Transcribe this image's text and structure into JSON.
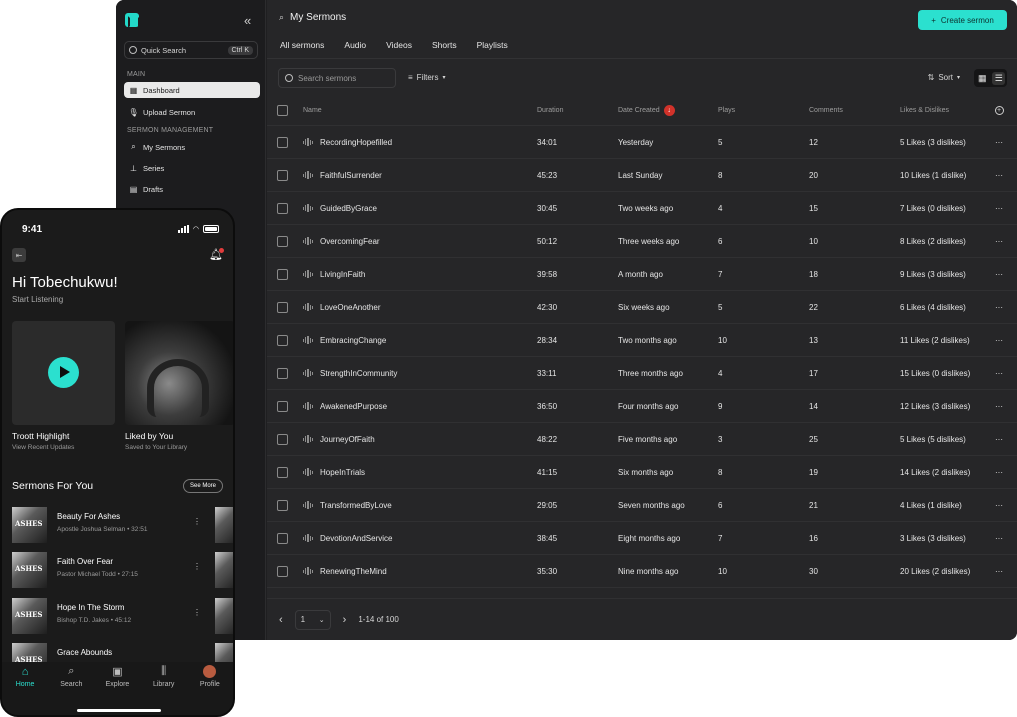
{
  "sidebar": {
    "quick_search": "Quick Search",
    "quick_search_kbd": "Ctrl K",
    "section_main": "MAIN",
    "section_mgmt": "SERMON MANAGEMENT",
    "items": [
      {
        "label": "Dashboard",
        "icon": "dashboard-icon"
      },
      {
        "label": "Upload Sermon",
        "icon": "microphone-icon"
      },
      {
        "label": "My Sermons",
        "icon": "megaphone-icon"
      },
      {
        "label": "Series",
        "icon": "series-icon"
      },
      {
        "label": "Drafts",
        "icon": "drafts-icon"
      }
    ]
  },
  "header": {
    "title": "My Sermons",
    "create_label": "Create sermon"
  },
  "tabs": [
    "All sermons",
    "Audio",
    "Videos",
    "Shorts",
    "Playlists"
  ],
  "toolbar": {
    "search_placeholder": "Search sermons",
    "filters_label": "Filters",
    "sort_label": "Sort"
  },
  "table": {
    "columns": [
      "Name",
      "Duration",
      "Date Created",
      "Plays",
      "Comments",
      "Likes & Dislikes"
    ],
    "rows": [
      {
        "name": "RecordingHopefilled",
        "duration": "34:01",
        "date": "Yesterday",
        "plays": "5",
        "comments": "12",
        "likes": "5 Likes (3 dislikes)"
      },
      {
        "name": "FaithfulSurrender",
        "duration": "45:23",
        "date": "Last Sunday",
        "plays": "8",
        "comments": "20",
        "likes": "10 Likes (1 dislike)"
      },
      {
        "name": "GuidedByGrace",
        "duration": "30:45",
        "date": "Two weeks ago",
        "plays": "4",
        "comments": "15",
        "likes": "7 Likes (0 dislikes)"
      },
      {
        "name": "OvercomingFear",
        "duration": "50:12",
        "date": "Three weeks ago",
        "plays": "6",
        "comments": "10",
        "likes": "8 Likes (2 dislikes)"
      },
      {
        "name": "LivingInFaith",
        "duration": "39:58",
        "date": "A month ago",
        "plays": "7",
        "comments": "18",
        "likes": "9 Likes (3 dislikes)"
      },
      {
        "name": "LoveOneAnother",
        "duration": "42:30",
        "date": "Six weeks ago",
        "plays": "5",
        "comments": "22",
        "likes": "6 Likes (4 dislikes)"
      },
      {
        "name": "EmbracingChange",
        "duration": "28:34",
        "date": "Two months ago",
        "plays": "10",
        "comments": "13",
        "likes": "11 Likes (2 dislikes)"
      },
      {
        "name": "StrengthInCommunity",
        "duration": "33:11",
        "date": "Three months ago",
        "plays": "4",
        "comments": "17",
        "likes": "15 Likes (0 dislikes)"
      },
      {
        "name": "AwakenedPurpose",
        "duration": "36:50",
        "date": "Four months ago",
        "plays": "9",
        "comments": "14",
        "likes": "12 Likes (3 dislikes)"
      },
      {
        "name": "JourneyOfFaith",
        "duration": "48:22",
        "date": "Five months ago",
        "plays": "3",
        "comments": "25",
        "likes": "5 Likes (5 dislikes)"
      },
      {
        "name": "HopeInTrials",
        "duration": "41:15",
        "date": "Six months ago",
        "plays": "8",
        "comments": "19",
        "likes": "14 Likes (2 dislikes)"
      },
      {
        "name": "TransformedByLove",
        "duration": "29:05",
        "date": "Seven months ago",
        "plays": "6",
        "comments": "21",
        "likes": "4 Likes (1 dislike)"
      },
      {
        "name": "DevotionAndService",
        "duration": "38:45",
        "date": "Eight months ago",
        "plays": "7",
        "comments": "16",
        "likes": "3 Likes (3 dislikes)"
      },
      {
        "name": "RenewingTheMind",
        "duration": "35:30",
        "date": "Nine months ago",
        "plays": "10",
        "comments": "30",
        "likes": "20 Likes (2 dislikes)"
      }
    ]
  },
  "pager": {
    "page": "1",
    "range": "1-14 of 100"
  },
  "phone": {
    "time": "9:41",
    "greeting": "Hi Tobechukwu!",
    "subtitle": "Start Listening",
    "cards": [
      {
        "title": "Troott Highlight",
        "sub": "View Recent Updates"
      },
      {
        "title": "Liked by You",
        "sub": "Saved to Your Library"
      }
    ],
    "section_title": "Sermons  For You",
    "see_more": "See More",
    "songs": [
      {
        "title": "Beauty For Ashes",
        "meta": "Apostle Joshua Selman   •   32:51"
      },
      {
        "title": "Faith Over Fear",
        "meta": "Pastor Michael Todd   •   27:15"
      },
      {
        "title": "Hope In The Storm",
        "meta": "Bishop T.D. Jakes   •   45:12"
      },
      {
        "title": "Grace Abounds",
        "meta": ""
      }
    ],
    "tabbar": [
      "Home",
      "Search",
      "Explore",
      "Library",
      "Profile"
    ]
  },
  "colors": {
    "accent": "#2be0cf",
    "sort_badge": "#d1322a",
    "bg_dark": "#262628"
  }
}
